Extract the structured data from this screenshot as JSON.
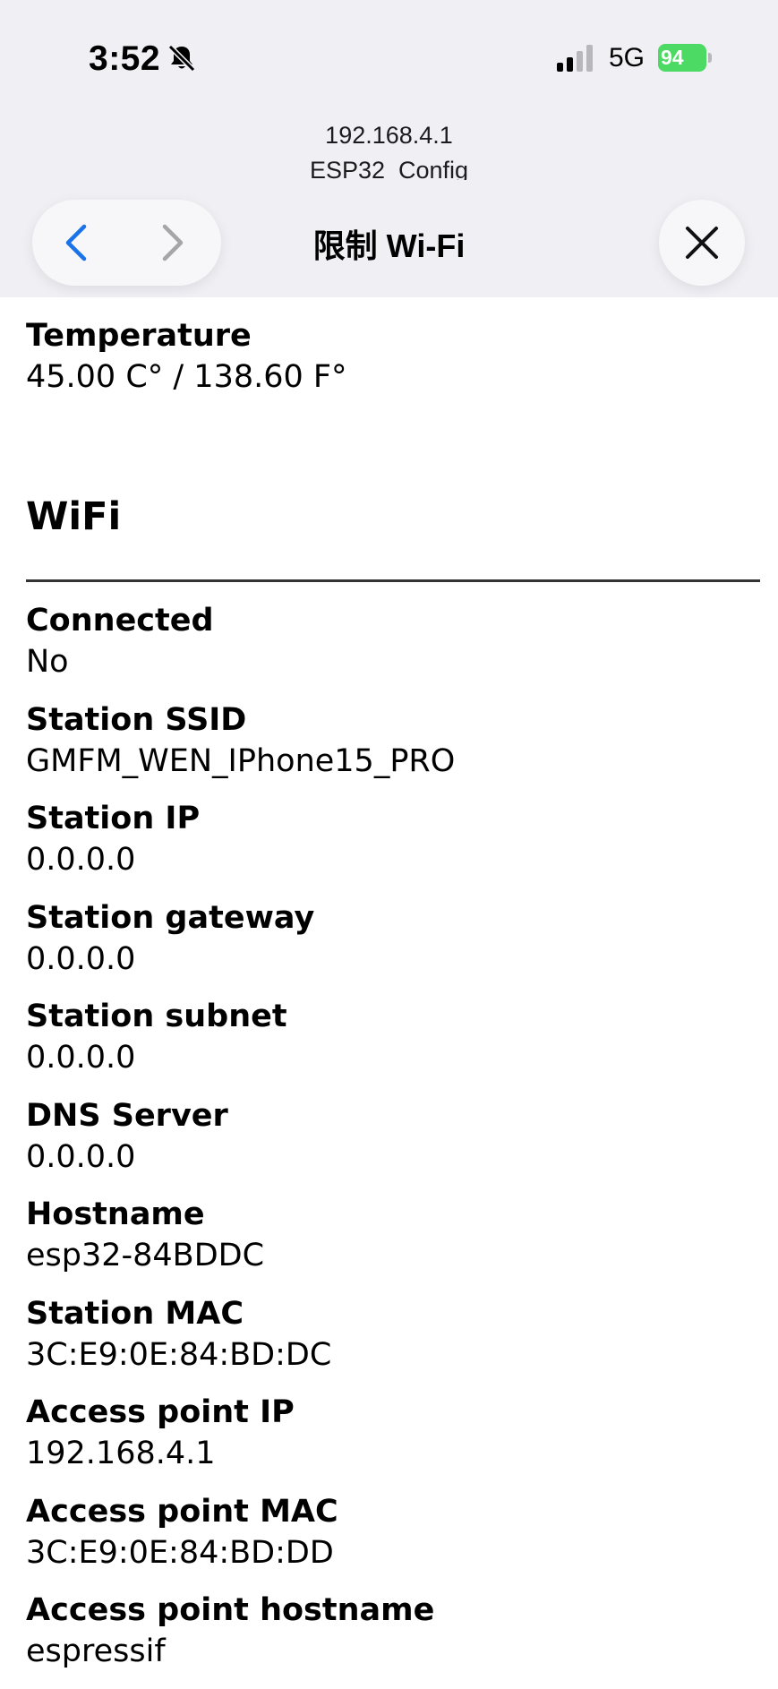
{
  "status_bar": {
    "time": "3:52",
    "network": "5G",
    "battery": "94"
  },
  "browser": {
    "url": "192.168.4.1",
    "page_title": "ESP32_Config",
    "nav_title": "限制 Wi-Fi"
  },
  "temperature": {
    "label": "Temperature",
    "value": "45.00 C° / 138.60 F°"
  },
  "wifi": {
    "title": "WiFi",
    "items": [
      {
        "label": "Connected",
        "value": "No"
      },
      {
        "label": "Station SSID",
        "value": "GMFM_WEN_IPhone15_PRO"
      },
      {
        "label": "Station IP",
        "value": "0.0.0.0"
      },
      {
        "label": "Station gateway",
        "value": "0.0.0.0"
      },
      {
        "label": "Station subnet",
        "value": "0.0.0.0"
      },
      {
        "label": "DNS Server",
        "value": "0.0.0.0"
      },
      {
        "label": "Hostname",
        "value": "esp32-84BDDC"
      },
      {
        "label": "Station MAC",
        "value": "3C:E9:0E:84:BD:DC"
      },
      {
        "label": "Access point IP",
        "value": "192.168.4.1"
      },
      {
        "label": "Access point MAC",
        "value": "3C:E9:0E:84:BD:DD"
      },
      {
        "label": "Access point hostname",
        "value": "espressif"
      }
    ]
  },
  "colors": {
    "accent": "#1a73e8",
    "battery": "#4cd964"
  }
}
